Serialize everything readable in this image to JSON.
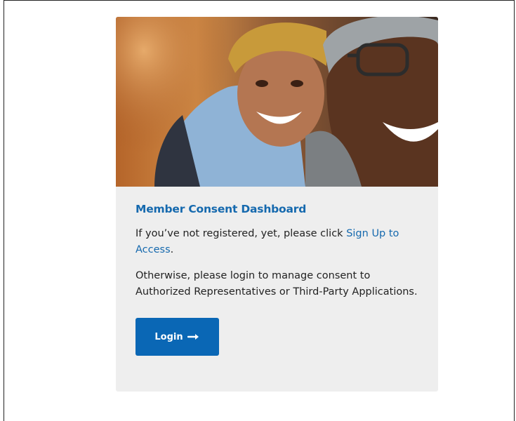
{
  "card": {
    "hero_image": "parent-and-child-photo",
    "title": "Member Consent Dashboard",
    "intro_text": "If you’ve not registered, yet, please click ",
    "signup_link": "Sign Up to Access",
    "intro_suffix": ".",
    "body_text": "Otherwise, please login to manage consent to Authorized Representatives or Third-Party Applications.",
    "login_button": "Login",
    "login_icon": "arrow-right-icon"
  },
  "colors": {
    "accent": "#1569ae",
    "button": "#0a67b5",
    "card_bg": "#eeeeee"
  }
}
